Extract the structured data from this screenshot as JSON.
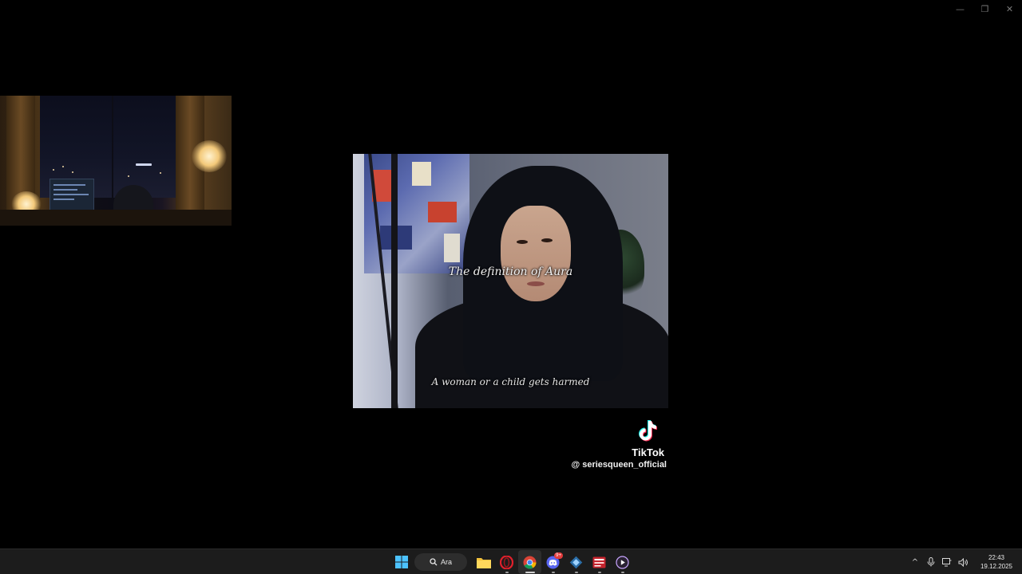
{
  "window_controls": {
    "minimize": "—",
    "restore": "❐",
    "close": "✕"
  },
  "video": {
    "caption_top": "The definition of Aura",
    "caption_bottom": "A woman or a child gets harmed"
  },
  "watermark": {
    "brand": "TikTok",
    "handle": "@ seriesqueen_official"
  },
  "taskbar": {
    "search_label": "Ara",
    "apps": [
      {
        "name": "start-button",
        "icon": "windows-logo-icon"
      },
      {
        "name": "search",
        "icon": "search-icon"
      },
      {
        "name": "file-explorer",
        "icon": "folder-icon"
      },
      {
        "name": "opera",
        "icon": "opera-icon"
      },
      {
        "name": "chrome",
        "icon": "chrome-icon",
        "active": true
      },
      {
        "name": "discord",
        "icon": "discord-icon",
        "badge": "9+"
      },
      {
        "name": "app-blue",
        "icon": "diamond-app-icon"
      },
      {
        "name": "app-red",
        "icon": "red-app-icon"
      },
      {
        "name": "media-player",
        "icon": "play-icon"
      }
    ],
    "tray": {
      "chevron": "^",
      "clock_time": "22:43",
      "clock_date": "19.12.2025"
    }
  },
  "colors": {
    "background": "#000000",
    "taskbar": "#1c1c1c",
    "caption_text": "#f2f2f2"
  }
}
